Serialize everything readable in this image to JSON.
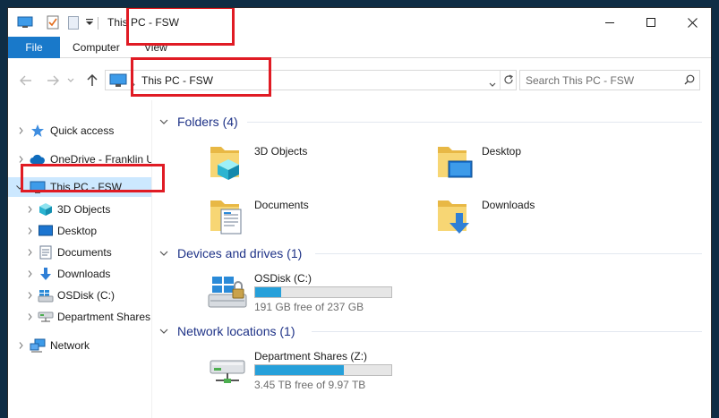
{
  "window": {
    "title": "This PC - FSW"
  },
  "ribbon": {
    "tabs": [
      "File",
      "Computer",
      "View"
    ]
  },
  "address": {
    "path": "This PC - FSW"
  },
  "search": {
    "placeholder": "Search This PC - FSW"
  },
  "nav": {
    "items": [
      {
        "label": "Quick access"
      },
      {
        "label": "OneDrive - Franklin U"
      },
      {
        "label": "This PC - FSW"
      },
      {
        "label": "3D Objects"
      },
      {
        "label": "Desktop"
      },
      {
        "label": "Documents"
      },
      {
        "label": "Downloads"
      },
      {
        "label": "OSDisk (C:)"
      },
      {
        "label": "Department Shares"
      },
      {
        "label": "Network"
      }
    ]
  },
  "groups": {
    "folders": {
      "title": "Folders (4)",
      "items": [
        "3D Objects",
        "Desktop",
        "Documents",
        "Downloads"
      ]
    },
    "devices": {
      "title": "Devices and drives (1)",
      "items": [
        {
          "name": "OSDisk (C:)",
          "free": "191 GB free of 237 GB",
          "used_fraction": 0.194
        }
      ]
    },
    "network": {
      "title": "Network locations (1)",
      "items": [
        {
          "name": "Department Shares (Z:)",
          "free": "3.45 TB free of 9.97 TB",
          "used_fraction": 0.654
        }
      ]
    }
  },
  "colors": {
    "accent": "#1979ca",
    "group_title": "#1e3287",
    "selection": "#cce8ff",
    "bar_fill": "#26a0da",
    "annotation": "#e01b24"
  }
}
